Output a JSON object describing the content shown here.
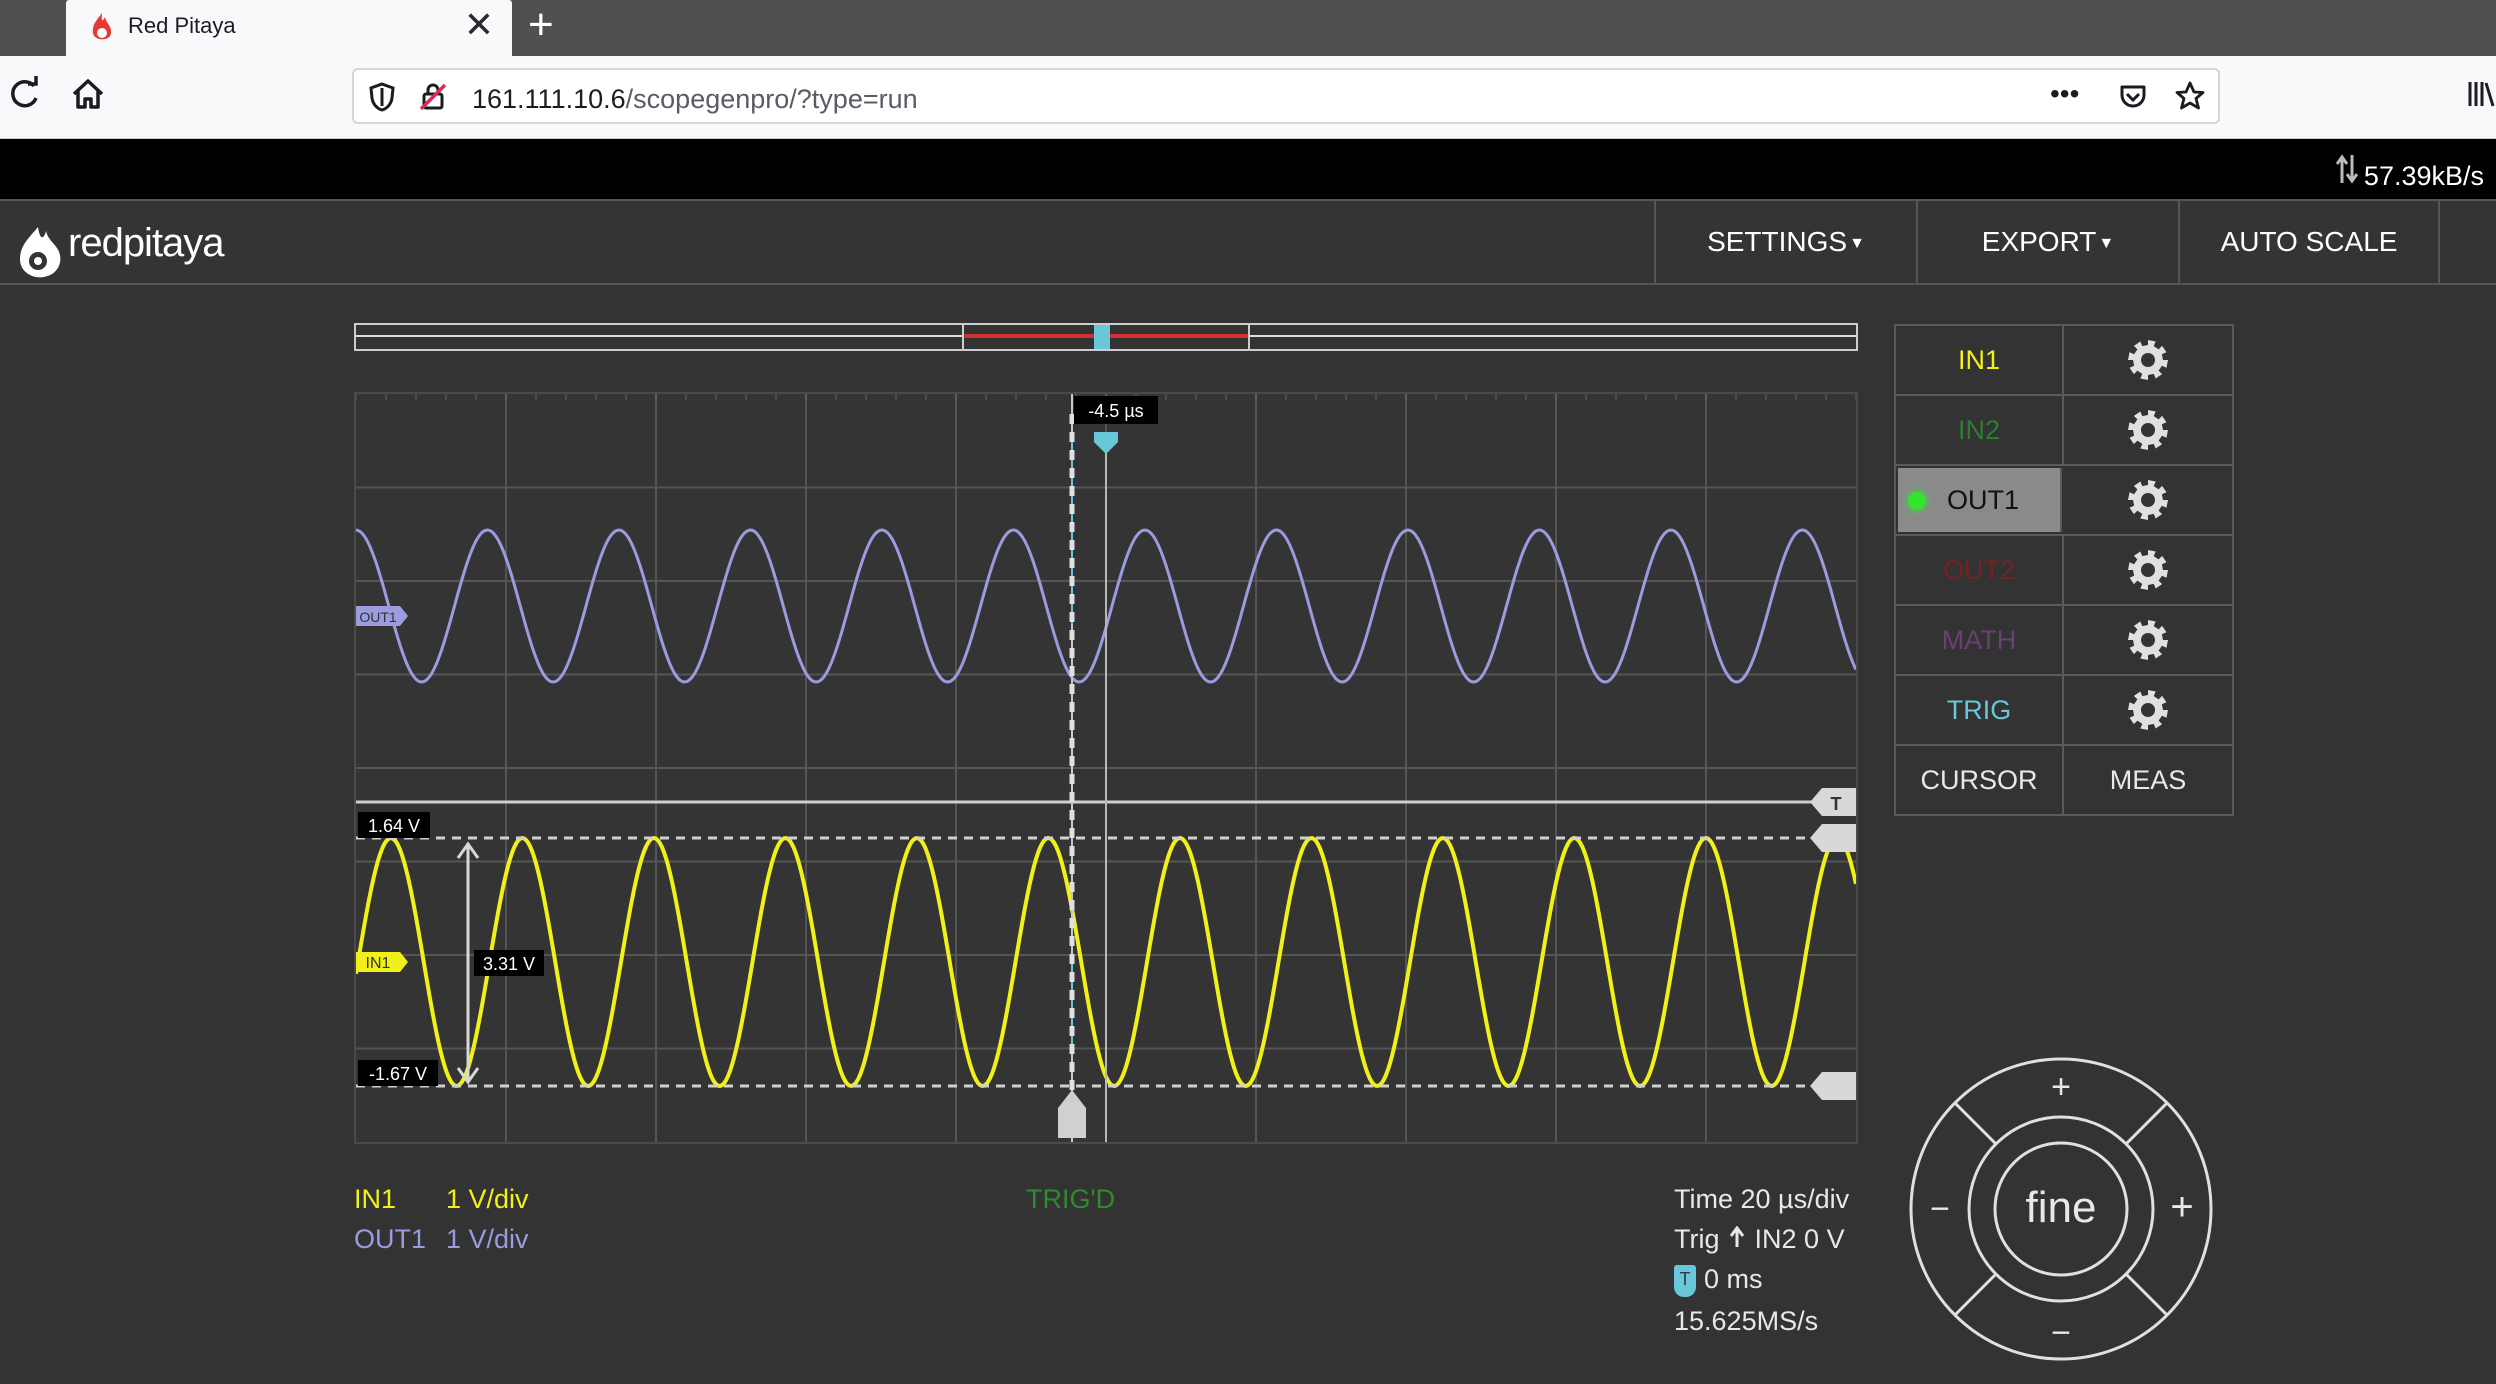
{
  "browser": {
    "tab_title": "Red Pitaya",
    "tab_close": "✕",
    "new_tab": "+",
    "url_host": "161.111.10.6",
    "url_path": "/scopegenpro/?type=run",
    "url_menu": "•••"
  },
  "app": {
    "transfer_speed": "57.39kB/s",
    "logo_text": "redpitaya",
    "menu": {
      "settings": "SETTINGS",
      "export": "EXPORT",
      "auto_scale": "AUTO SCALE"
    }
  },
  "scope": {
    "trigger_time_label": "-4.5 µs",
    "cursor_top_label": "1.64 V",
    "cursor_bottom_label": "-1.67 V",
    "cursor_delta_label": "3.31 V",
    "marker_out1": "OUT1",
    "marker_in1": "IN1",
    "marker_trig": "T",
    "trig_status": "TRIG'D",
    "colors": {
      "in1": "#f1f118",
      "out1": "#9b9be0",
      "trig": "#68c7d9",
      "in2": "#2e7d32",
      "out2": "#7a2020",
      "math": "#6a3f72"
    }
  },
  "scales": {
    "in1_name": "IN1",
    "in1_scale": "1 V/div",
    "out1_name": "OUT1",
    "out1_scale": "1 V/div"
  },
  "timing": {
    "time_div": "Time 20 µs/div",
    "trig_prefix": "Trig",
    "trig_src": "IN2 0 V",
    "delay_badge": "T",
    "delay": "0 ms",
    "sample_rate": "15.625MS/s"
  },
  "channels": [
    {
      "label": "IN1",
      "color": "#f1f118",
      "active": false
    },
    {
      "label": "IN2",
      "color": "#2e7d32",
      "active": false
    },
    {
      "label": "OUT1",
      "color": "#111111",
      "active": true
    },
    {
      "label": "OUT2",
      "color": "#7a2020",
      "active": false
    },
    {
      "label": "MATH",
      "color": "#6a3f72",
      "active": false
    },
    {
      "label": "TRIG",
      "color": "#68c7d9",
      "active": false
    }
  ],
  "tools": {
    "cursor": "CURSOR",
    "meas": "MEAS"
  },
  "jog": {
    "center": "fine",
    "up": "+",
    "down": "−",
    "left": "−",
    "right": "+"
  }
}
